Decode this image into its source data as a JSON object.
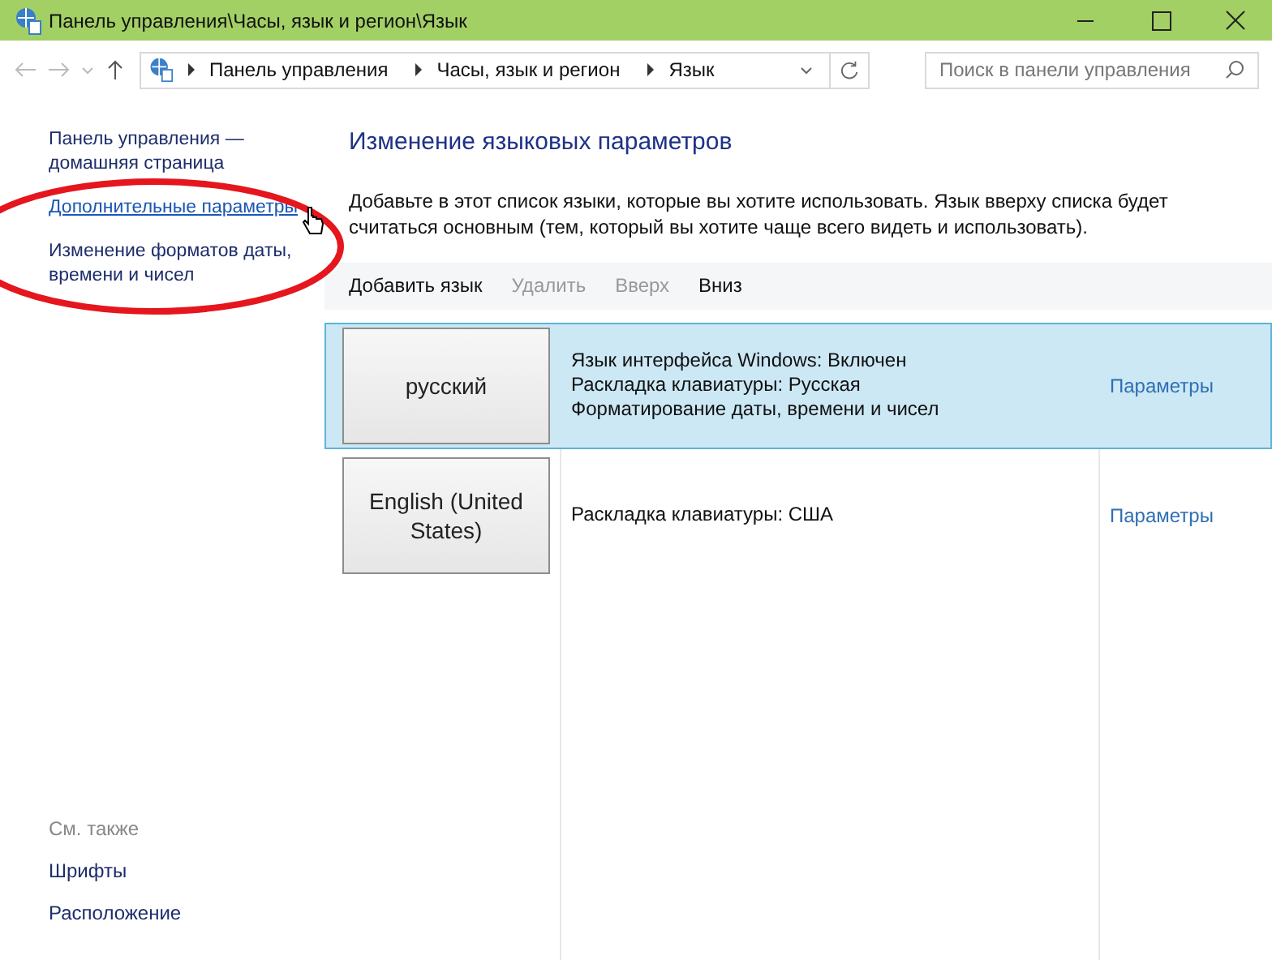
{
  "window": {
    "title": "Панель управления\\Часы, язык и регион\\Язык"
  },
  "address_bar": {
    "crumbs": [
      "Панель управления",
      "Часы, язык и регион",
      "Язык"
    ]
  },
  "search": {
    "placeholder": "Поиск в панели управления"
  },
  "sidebar": {
    "items": [
      {
        "label": "Панель управления — домашняя страница",
        "hovered": false
      },
      {
        "label": "Дополнительные параметры",
        "hovered": true
      },
      {
        "label": "Изменение форматов даты, времени и чисел",
        "hovered": false
      }
    ],
    "see_also": {
      "heading": "См. также",
      "links": [
        "Шрифты",
        "Расположение"
      ]
    }
  },
  "heading": "Изменение языковых параметров",
  "description": "Добавьте в этот список языки, которые вы хотите использовать. Язык вверху списка будет считаться основным (тем, который вы хотите чаще всего видеть и использовать).",
  "toolbar": [
    {
      "label": "Добавить язык",
      "disabled": false
    },
    {
      "label": "Удалить",
      "disabled": true
    },
    {
      "label": "Вверх",
      "disabled": true
    },
    {
      "label": "Вниз",
      "disabled": false
    }
  ],
  "languages": [
    {
      "name": "русский",
      "selected": true,
      "details": [
        "Язык интерфейса Windows: Включен",
        "Раскладка клавиатуры: Русская",
        "Форматирование даты, времени и чисел"
      ],
      "link": "Параметры"
    },
    {
      "name": "English (United States)",
      "selected": false,
      "details": [
        "Раскладка клавиатуры: США"
      ],
      "link": "Параметры"
    }
  ]
}
